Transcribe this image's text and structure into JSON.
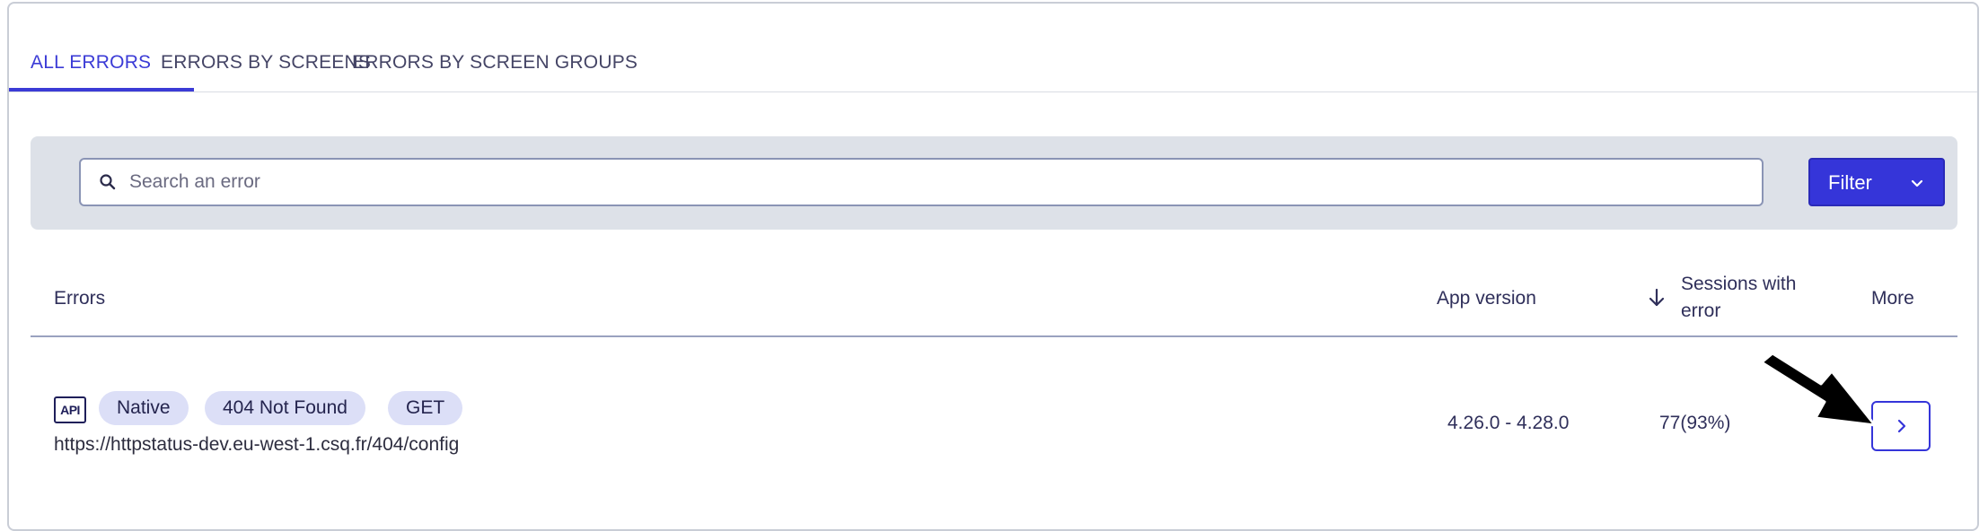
{
  "tabs": [
    {
      "label": "ALL ERRORS",
      "active": true
    },
    {
      "label": "ERRORS BY SCREENS",
      "active": false
    },
    {
      "label": "ERRORS BY SCREEN GROUPS",
      "active": false
    }
  ],
  "search": {
    "placeholder": "Search an error",
    "value": ""
  },
  "filter": {
    "label": "Filter"
  },
  "table": {
    "headers": {
      "errors": "Errors",
      "app_version": "App version",
      "sessions_line1": "Sessions with",
      "sessions_line2": "error",
      "more": "More"
    },
    "rows": [
      {
        "type_icon": "API",
        "tags": [
          "Native",
          "404 Not Found",
          "GET"
        ],
        "url": "https://httpstatus-dev.eu-west-1.csq.fr/404/config",
        "app_version": "4.26.0 - 4.28.0",
        "sessions": "77(93%)"
      }
    ]
  },
  "colors": {
    "accent": "#3535d9",
    "chip_bg": "#dcdff7",
    "search_band": "#dde1e8"
  },
  "icons": {
    "search": "search-icon",
    "filter_chevron": "chevron-down-icon",
    "sort": "arrow-down-icon",
    "row_more": "chevron-right-icon",
    "cursor": "pointer-arrow-icon"
  }
}
